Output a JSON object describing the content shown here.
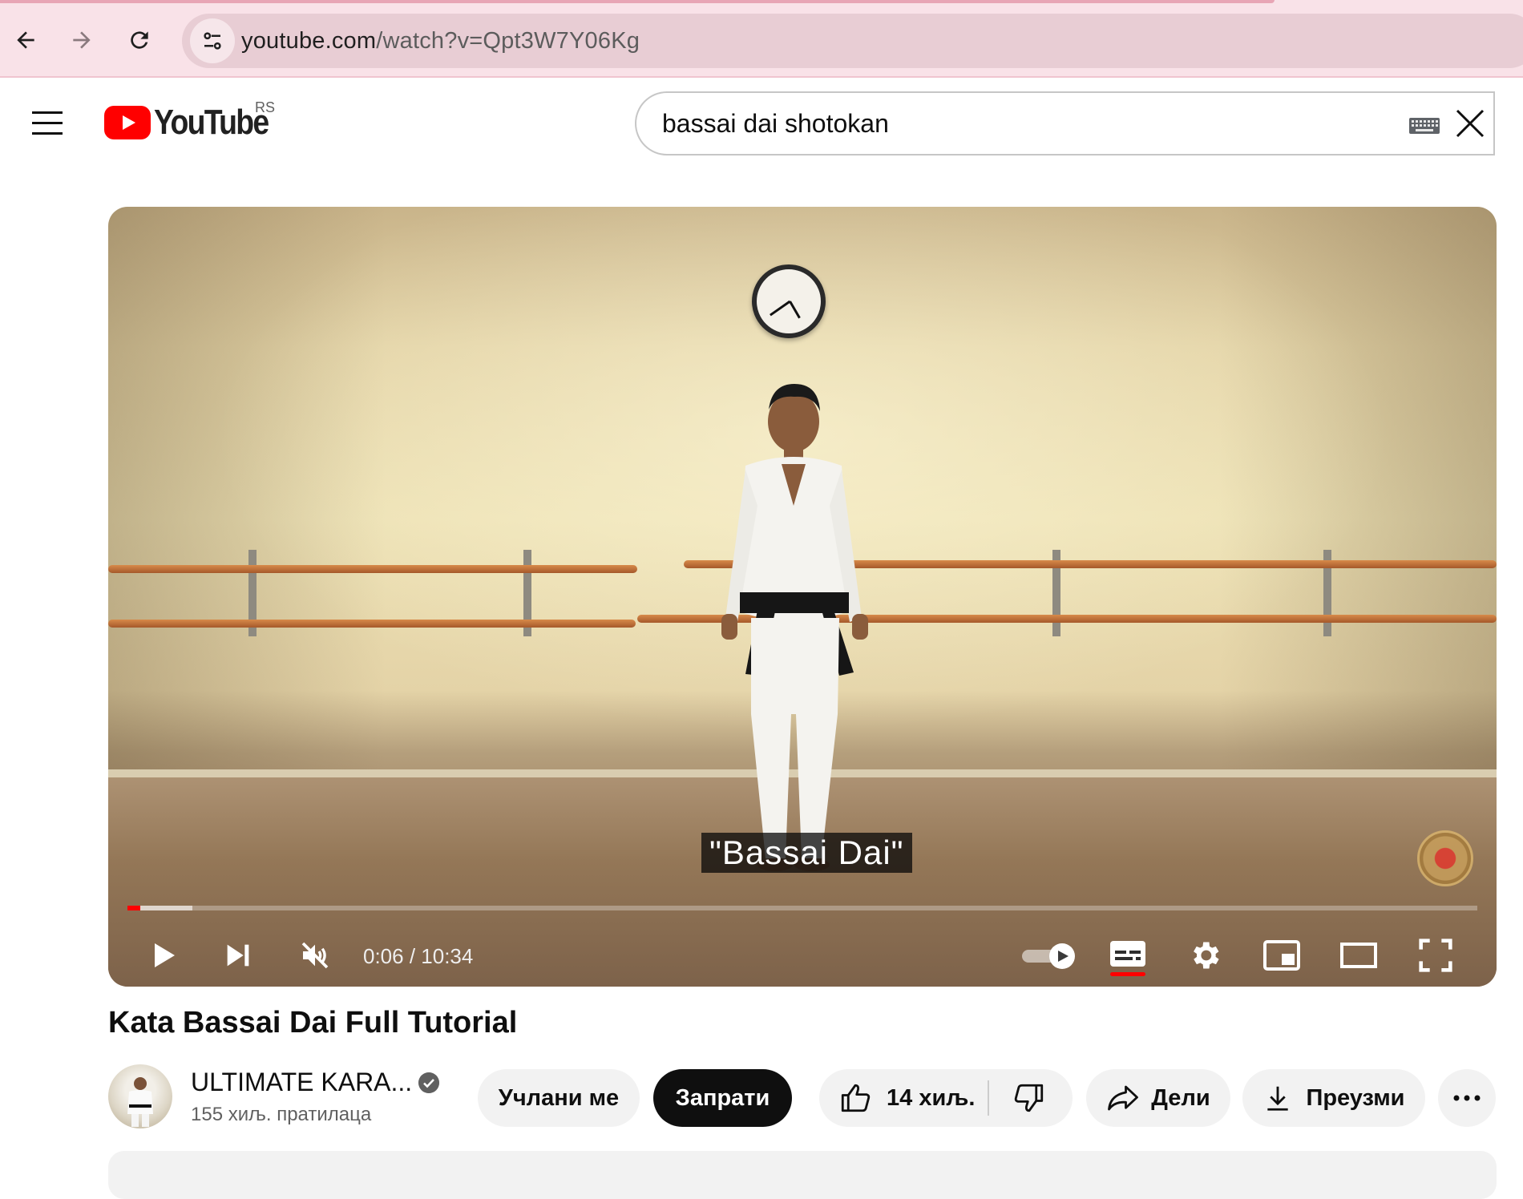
{
  "browser": {
    "url_host": "youtube.com",
    "url_path": "/watch?v=Qpt3W7Y06Kg"
  },
  "header": {
    "logo_text": "YouTube",
    "country_code": "RS",
    "search_value": "bassai dai shotokan"
  },
  "player": {
    "caption_text": "\"Bassai Dai\"",
    "time_display": "0:06 / 10:34",
    "progress_fraction": 0.0096,
    "buffered_fraction": 0.048,
    "muted": true,
    "autoplay_on": true,
    "subtitles_on": true
  },
  "video": {
    "title": "Kata Bassai Dai Full Tutorial",
    "channel_name": "ULTIMATE KARA...",
    "subscribers": "155 хиљ. пратилаца",
    "join_label": "Учлани ме",
    "subscribe_label": "Запрати",
    "likes": "14 хиљ.",
    "share_label": "Дели",
    "download_label": "Преузми"
  },
  "colors": {
    "accent_red": "#ff0000",
    "chrome_bg": "#f9e2e8",
    "urlbar_bg": "#e8cdd4"
  }
}
